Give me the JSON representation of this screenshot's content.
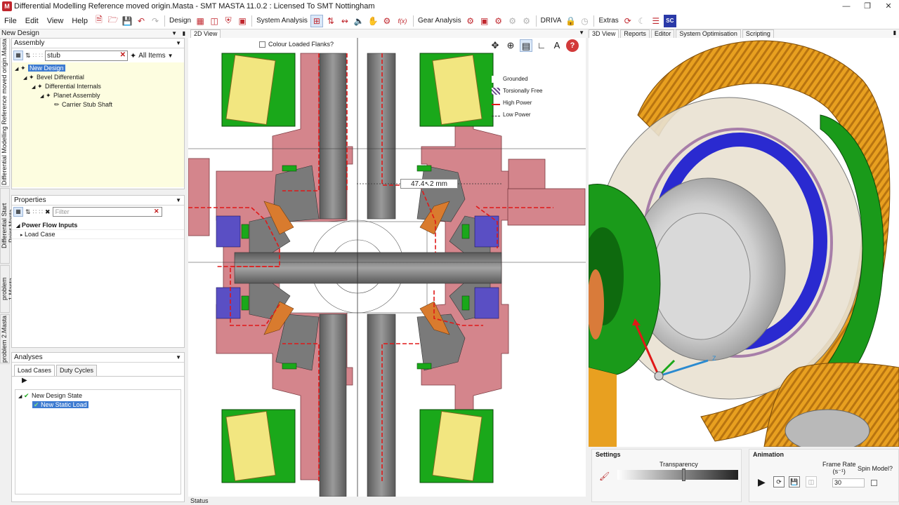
{
  "window": {
    "title": "Differential Modelling Reference moved origin.Masta - SMT MASTA 11.0.2 : Licensed To SMT Nottingham",
    "app_icon": "M"
  },
  "menu": [
    "File",
    "Edit",
    "View",
    "Help"
  ],
  "toolbar": {
    "design_label": "Design",
    "system_analysis_label": "System Analysis",
    "gear_analysis_label": "Gear Analysis",
    "driva_label": "DRIVA",
    "extras_label": "Extras",
    "sc_label": "SC",
    "fx_label": "f(x)"
  },
  "left": {
    "design_title": "New Design",
    "vertical_tabs": [
      "Differential Modelling Reference moved origin.Masta",
      "Differential Start Point.Masta",
      "problem 1.Masta",
      "problem 2.Masta"
    ],
    "assembly": {
      "title": "Assembly",
      "search_value": "stub",
      "filter_label": "All Items",
      "tree": [
        {
          "label": "New Design",
          "level": 0,
          "selected": true
        },
        {
          "label": "Bevel Differential",
          "level": 1
        },
        {
          "label": "Differential Internals",
          "level": 2
        },
        {
          "label": "Planet Assembly",
          "level": 3
        },
        {
          "label": "Carrier Stub Shaft",
          "level": 4
        }
      ]
    },
    "properties": {
      "title": "Properties",
      "filter_placeholder": "Filter",
      "rows": [
        "Power Flow Inputs",
        "Load Case"
      ]
    },
    "analyses": {
      "title": "Analyses",
      "tabs": [
        "Load Cases",
        "Duty Cycles"
      ],
      "tree": [
        {
          "label": "New Design State",
          "level": 0
        },
        {
          "label": "New Static Load",
          "level": 1,
          "selected": true
        }
      ]
    }
  },
  "view2d": {
    "tab": "2D View",
    "colour_flanks_label": "Colour Loaded Flanks?",
    "legend": [
      "Grounded",
      "Torsionally Free",
      "High Power",
      "Low Power"
    ],
    "measurement": "47.4",
    "measurement_unit": "2 mm",
    "status": "Status"
  },
  "view3d": {
    "tabs": [
      "3D View",
      "Reports",
      "Editor",
      "System Optimisation",
      "Scripting"
    ],
    "axis_label": "Z"
  },
  "settings": {
    "title": "Settings",
    "transparency_label": "Transparency",
    "transparency": 0.56
  },
  "animation": {
    "title": "Animation",
    "frame_rate_label": "Frame Rate",
    "frame_rate_unit": "(s⁻¹)",
    "frame_rate": "30",
    "spin_label": "Spin Model?"
  },
  "colors": {
    "housing": "#d4858c",
    "gear_gray": "#7a7a7a",
    "shaft_gray": "#8a8a8a",
    "bearing_green": "#1aa81a",
    "roller_yellow": "#f2e680",
    "thrust_blue": "#5a4fc4",
    "washer_orange": "#d97b2e",
    "power_red": "#e01818",
    "highlight_blue": "#3d7bd1",
    "tree_bg": "#fdfde0",
    "ring_gear_orange": "#e8a020"
  }
}
